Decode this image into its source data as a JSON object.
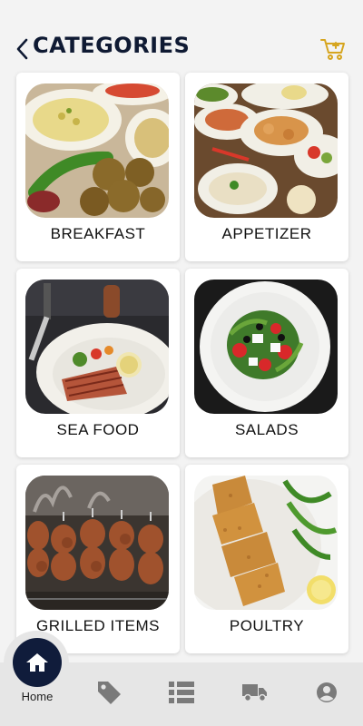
{
  "header": {
    "title": "CATEGORIES",
    "back_icon": "chevron-left-icon",
    "cart_icon": "cart-icon"
  },
  "colors": {
    "title": "#0f1a33",
    "accent_cart": "#d6a51f",
    "nav_active": "#101c3b",
    "nav_inactive": "#7a7a7a",
    "background": "#f3f3f3"
  },
  "categories": [
    {
      "label": "BREAKFAST"
    },
    {
      "label": "APPETIZER"
    },
    {
      "label": "SEA FOOD"
    },
    {
      "label": "SALADS"
    },
    {
      "label": "GRILLED ITEMS"
    },
    {
      "label": "POULTRY"
    }
  ],
  "bottom_nav": {
    "home_label": "Home",
    "items": [
      "home-icon",
      "tag-icon",
      "list-icon",
      "truck-icon",
      "user-circle-icon"
    ]
  }
}
